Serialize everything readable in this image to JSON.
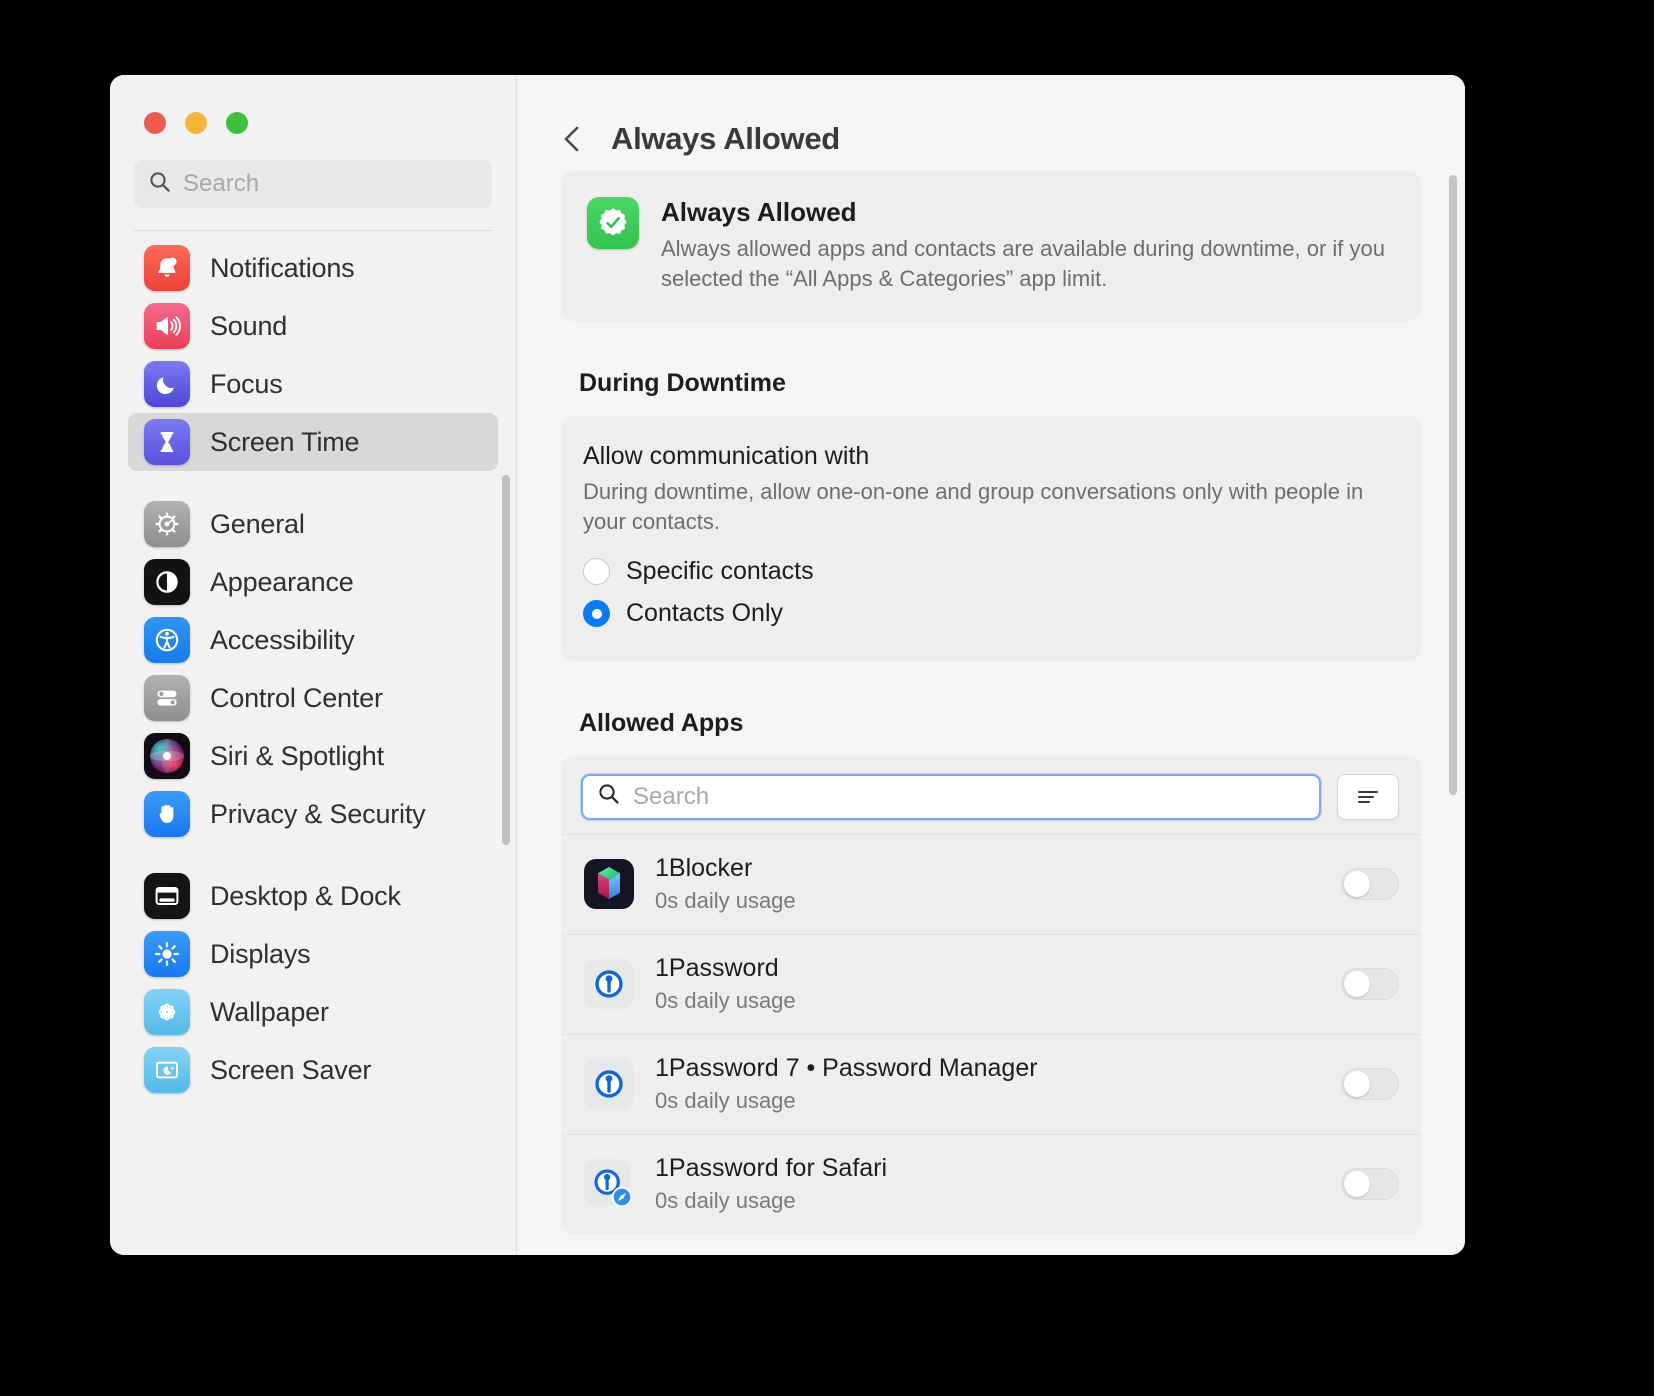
{
  "window": {
    "traffic_lights": [
      "close",
      "minimize",
      "zoom"
    ],
    "sidebar": {
      "search_placeholder": "Search",
      "search_icon": "search-icon",
      "groups": [
        {
          "items": [
            {
              "label": "Notifications",
              "icon": "notifications-icon",
              "selected": false
            },
            {
              "label": "Sound",
              "icon": "sound-icon",
              "selected": false
            },
            {
              "label": "Focus",
              "icon": "focus-icon",
              "selected": false
            },
            {
              "label": "Screen Time",
              "icon": "screen-time-icon",
              "selected": true
            }
          ]
        },
        {
          "items": [
            {
              "label": "General",
              "icon": "general-icon",
              "selected": false
            },
            {
              "label": "Appearance",
              "icon": "appearance-icon",
              "selected": false
            },
            {
              "label": "Accessibility",
              "icon": "accessibility-icon",
              "selected": false
            },
            {
              "label": "Control Center",
              "icon": "control-center-icon",
              "selected": false
            },
            {
              "label": "Siri & Spotlight",
              "icon": "siri-icon",
              "selected": false
            },
            {
              "label": "Privacy & Security",
              "icon": "privacy-icon",
              "selected": false
            }
          ]
        },
        {
          "items": [
            {
              "label": "Desktop & Dock",
              "icon": "desktop-dock-icon",
              "selected": false
            },
            {
              "label": "Displays",
              "icon": "displays-icon",
              "selected": false
            },
            {
              "label": "Wallpaper",
              "icon": "wallpaper-icon",
              "selected": false
            },
            {
              "label": "Screen Saver",
              "icon": "screen-saver-icon",
              "selected": false
            }
          ]
        }
      ]
    }
  },
  "header": {
    "back_icon": "chevron-left-icon",
    "title": "Always Allowed"
  },
  "info_card": {
    "icon": "always-allowed-badge-icon",
    "title": "Always Allowed",
    "description": "Always allowed apps and contacts are available during downtime, or if you selected the “All Apps & Categories” app limit."
  },
  "during_downtime": {
    "section_title": "During Downtime",
    "title": "Allow communication with",
    "description": "During downtime, allow one-on-one and group conversations only with people in your contacts.",
    "options": [
      {
        "label": "Specific contacts",
        "selected": false
      },
      {
        "label": "Contacts Only",
        "selected": true
      }
    ]
  },
  "allowed_apps": {
    "section_title": "Allowed Apps",
    "search_placeholder": "Search",
    "search_value": "",
    "search_icon": "search-icon",
    "filter_icon": "filter-lines-icon",
    "rows": [
      {
        "name": "1Blocker",
        "usage": "0s daily usage",
        "icon": "1blocker-icon",
        "enabled": false
      },
      {
        "name": "1Password",
        "usage": "0s daily usage",
        "icon": "1password-icon",
        "enabled": false
      },
      {
        "name": "1Password 7 • Password Manager",
        "usage": "0s daily usage",
        "icon": "1password7-icon",
        "enabled": false
      },
      {
        "name": "1Password for Safari",
        "usage": "0s daily usage",
        "icon": "1password-safari-icon",
        "enabled": false
      }
    ]
  },
  "colors": {
    "accent_blue": "#0a7bf5",
    "focus_ring": "#7ea6ef",
    "green_badge": "#34c24f",
    "window_bg": "#f5f5f5",
    "sidebar_bg": "#f2f2f2",
    "card_bg": "#eeeeee"
  }
}
